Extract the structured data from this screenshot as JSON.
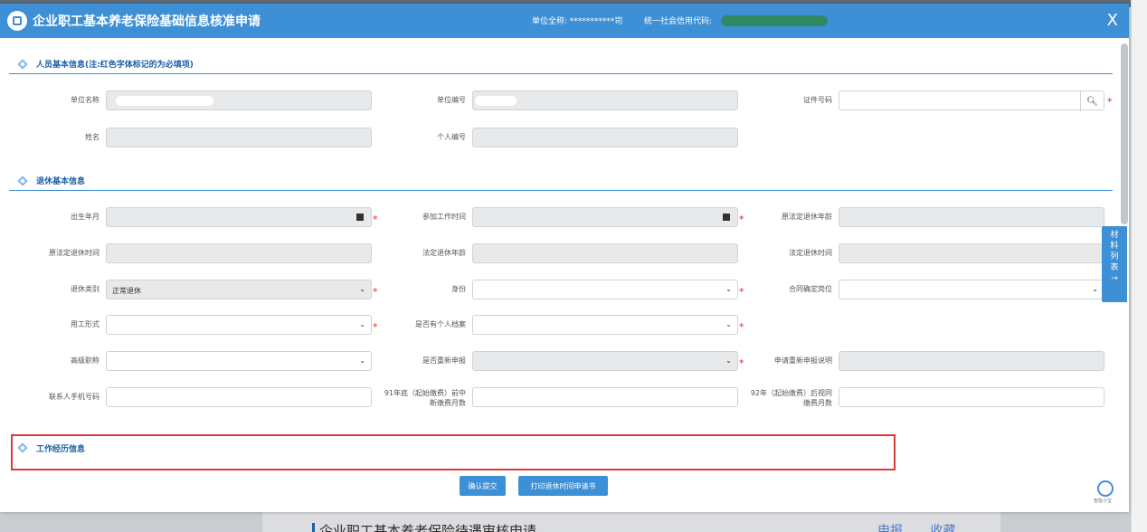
{
  "modal": {
    "title": "企业职工基本养老保险基础信息核准申请",
    "unit_label": "单位全称: ***********司",
    "credit_code_label": "统一社会信用代码:",
    "close": "X"
  },
  "sections": {
    "personal": "人员基本信息(注:红色字体标记的为必填项)",
    "retire": "退休基本信息",
    "work": "工作经历信息"
  },
  "personal_fields": {
    "unit_name": "单位名称",
    "unit_no": "单位编号",
    "id_no": "证件号码",
    "name": "姓名",
    "personal_no": "个人编号"
  },
  "retire_fields": {
    "birth": "出生年月",
    "work_start": "参加工作时间",
    "orig_age": "原法定退休年龄",
    "orig_time": "原法定退休时间",
    "legal_age": "法定退休年龄",
    "legal_time": "法定退休时间",
    "retire_type": "退休类别",
    "retire_type_value": "正常退休",
    "identity": "身份",
    "contract_pos": "合同确定岗位",
    "employment": "用工形式",
    "personal_file": "是否有个人档案",
    "senior_title": "高级职称",
    "redeclare": "是否重新申报",
    "redeclare_note": "申请重新申报说明",
    "phone": "联系人手机号码",
    "before91_line1": "91年底（起始缴费）前中",
    "before91_line2": "断缴费月数",
    "after92_line1": "92年（起始缴费）后视同",
    "after92_line2": "缴费月数"
  },
  "buttons": {
    "submit": "确认提交",
    "print": "打印退休时间申请书"
  },
  "side_tab": [
    "材",
    "料",
    "列",
    "表",
    "→"
  ],
  "assistant_label": "智能小宝",
  "background": {
    "title": "企业职工基本养老保险待遇审核申请",
    "declare": "申报",
    "favorite": "收藏"
  },
  "colors": {
    "primary": "#3d8fd6",
    "required": "#e0281f",
    "highlight": "#d93a3a"
  }
}
